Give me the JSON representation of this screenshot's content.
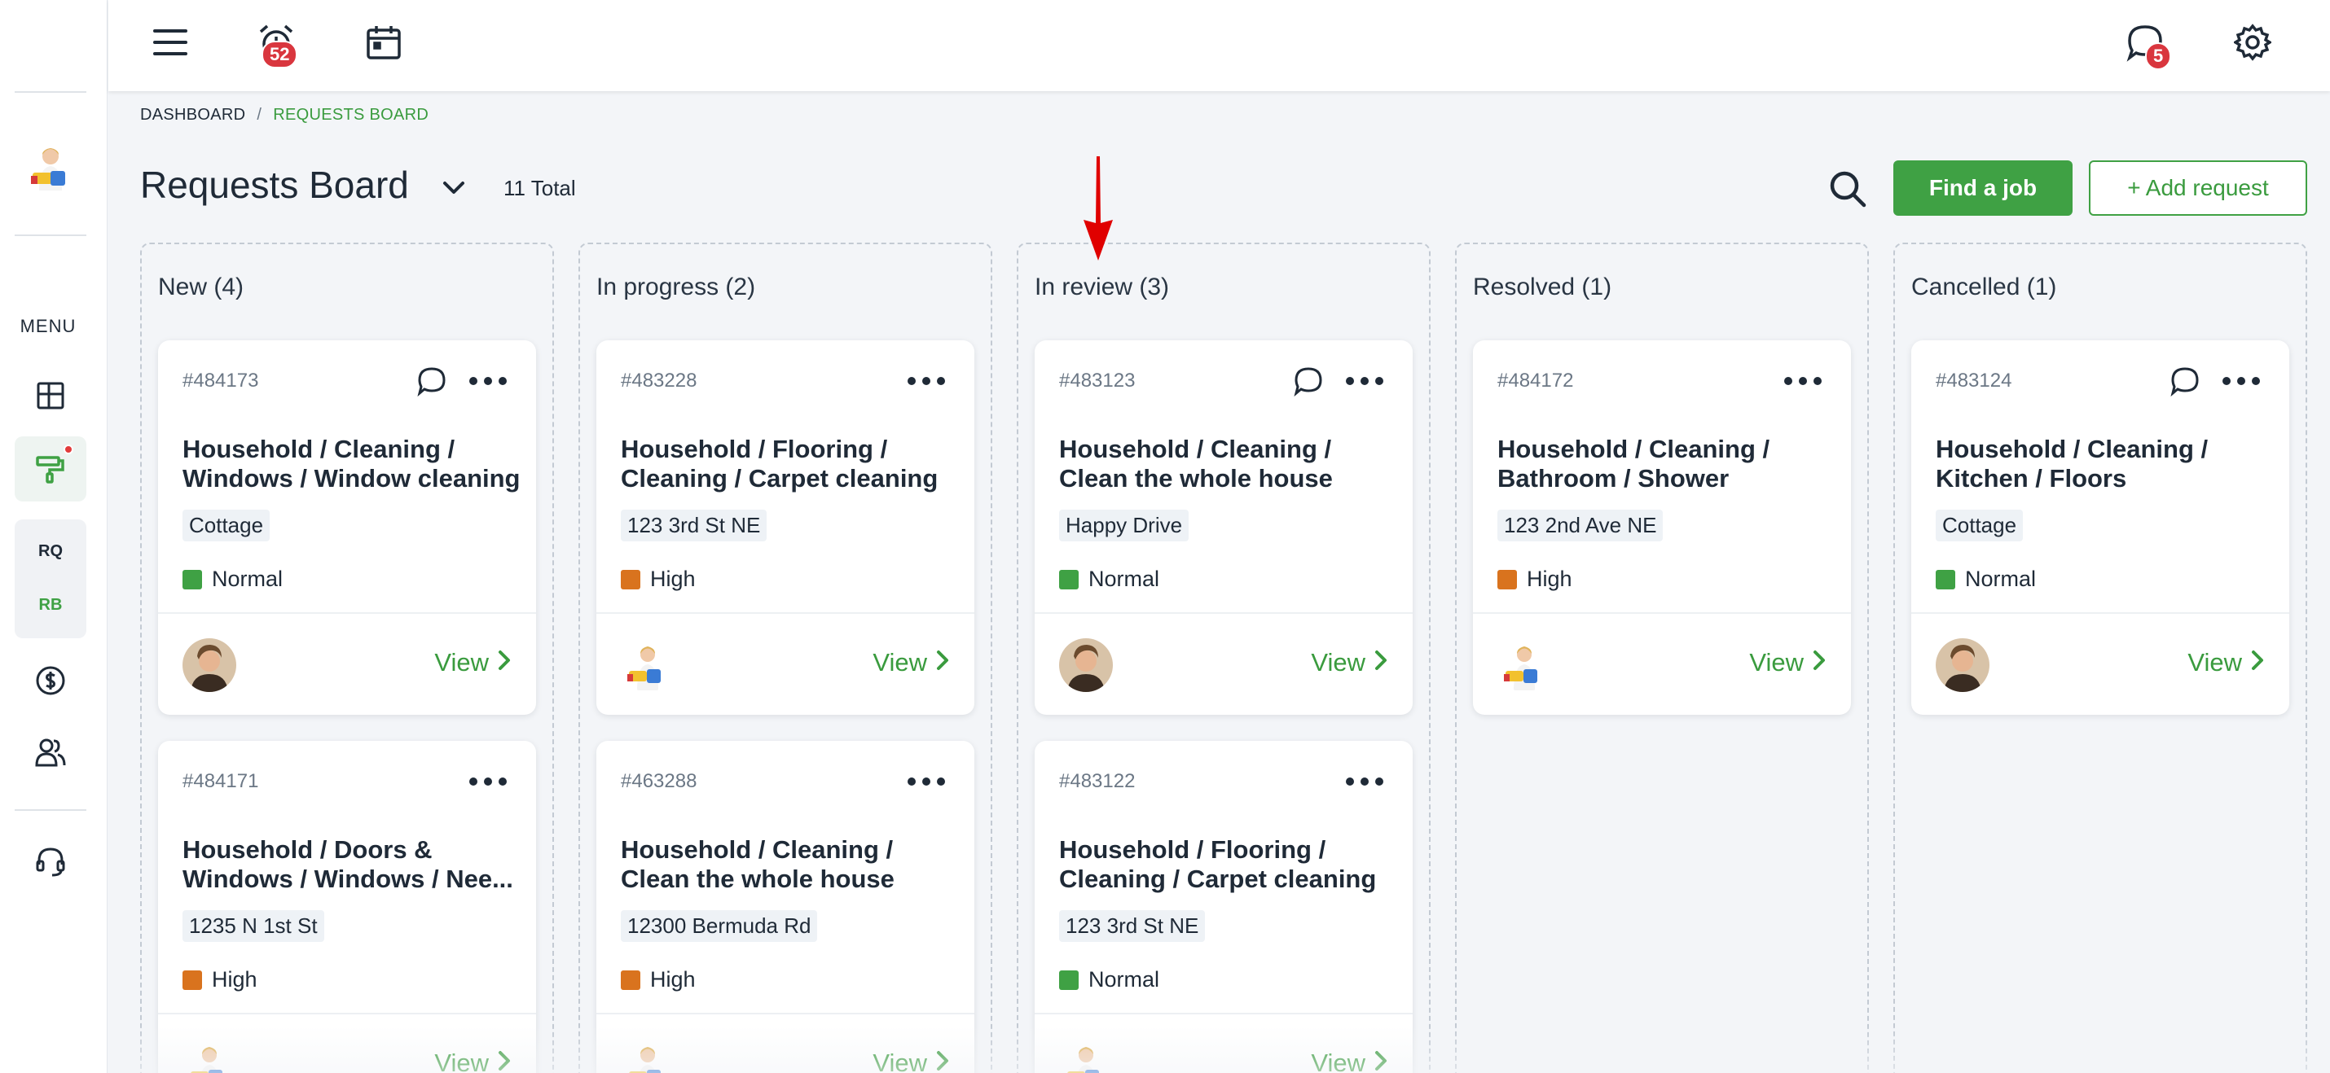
{
  "sidebar": {
    "menu_label": "MENU",
    "rq_label": "RQ",
    "rb_label": "RB"
  },
  "topbar": {
    "alarm_badge": "52",
    "messages_badge": "5"
  },
  "breadcrumb": {
    "home": "DASHBOARD",
    "separator": "/",
    "current": "REQUESTS BOARD"
  },
  "header": {
    "title": "Requests Board",
    "total": "11 Total",
    "find_job": "Find a job",
    "add_request": "+ Add request"
  },
  "colors": {
    "brand_green": "#3fa144",
    "priority_normal": "#3fa144",
    "priority_high": "#d9731e",
    "badge_red": "#d9363e",
    "annotation_arrow": "#e00000"
  },
  "columns": [
    {
      "title": "New (4)",
      "cards": [
        {
          "id": "#484173",
          "title1": "Household / Cleaning /",
          "title2": "Windows / Window cleaning",
          "tag": "Cottage",
          "priority": "Normal",
          "priority_color": "#3fa144",
          "avatar": "man",
          "chat": true,
          "view": "View"
        },
        {
          "id": "#484171",
          "title1": "Household / Doors &",
          "title2": "Windows / Windows / Nee...",
          "tag": "1235 N 1st St",
          "priority": "High",
          "priority_color": "#d9731e",
          "avatar": "cleaner",
          "chat": false,
          "view": "View"
        }
      ]
    },
    {
      "title": "In progress (2)",
      "cards": [
        {
          "id": "#483228",
          "title1": "Household / Flooring /",
          "title2": "Cleaning / Carpet cleaning",
          "tag": "123 3rd St NE",
          "priority": "High",
          "priority_color": "#d9731e",
          "avatar": "cleaner",
          "chat": false,
          "view": "View"
        },
        {
          "id": "#463288",
          "title1": "Household / Cleaning /",
          "title2": "Clean the whole house",
          "tag": "12300 Bermuda Rd",
          "priority": "High",
          "priority_color": "#d9731e",
          "avatar": "cleaner",
          "chat": false,
          "view": "View"
        }
      ]
    },
    {
      "title": "In review (3)",
      "cards": [
        {
          "id": "#483123",
          "title1": "Household / Cleaning /",
          "title2": "Clean the whole house",
          "tag": "Happy Drive",
          "priority": "Normal",
          "priority_color": "#3fa144",
          "avatar": "man",
          "chat": true,
          "view": "View"
        },
        {
          "id": "#483122",
          "title1": "Household / Flooring /",
          "title2": "Cleaning / Carpet cleaning",
          "tag": "123 3rd St NE",
          "priority": "Normal",
          "priority_color": "#3fa144",
          "avatar": "cleaner",
          "chat": false,
          "view": "View"
        }
      ]
    },
    {
      "title": "Resolved (1)",
      "cards": [
        {
          "id": "#484172",
          "title1": "Household / Cleaning /",
          "title2": "Bathroom / Shower",
          "tag": "123 2nd Ave NE",
          "priority": "High",
          "priority_color": "#d9731e",
          "avatar": "cleaner",
          "chat": false,
          "view": "View"
        }
      ]
    },
    {
      "title": "Cancelled (1)",
      "cards": [
        {
          "id": "#483124",
          "title1": "Household / Cleaning /",
          "title2": "Kitchen / Floors",
          "tag": "Cottage",
          "priority": "Normal",
          "priority_color": "#3fa144",
          "avatar": "man",
          "chat": true,
          "view": "View"
        }
      ]
    }
  ]
}
